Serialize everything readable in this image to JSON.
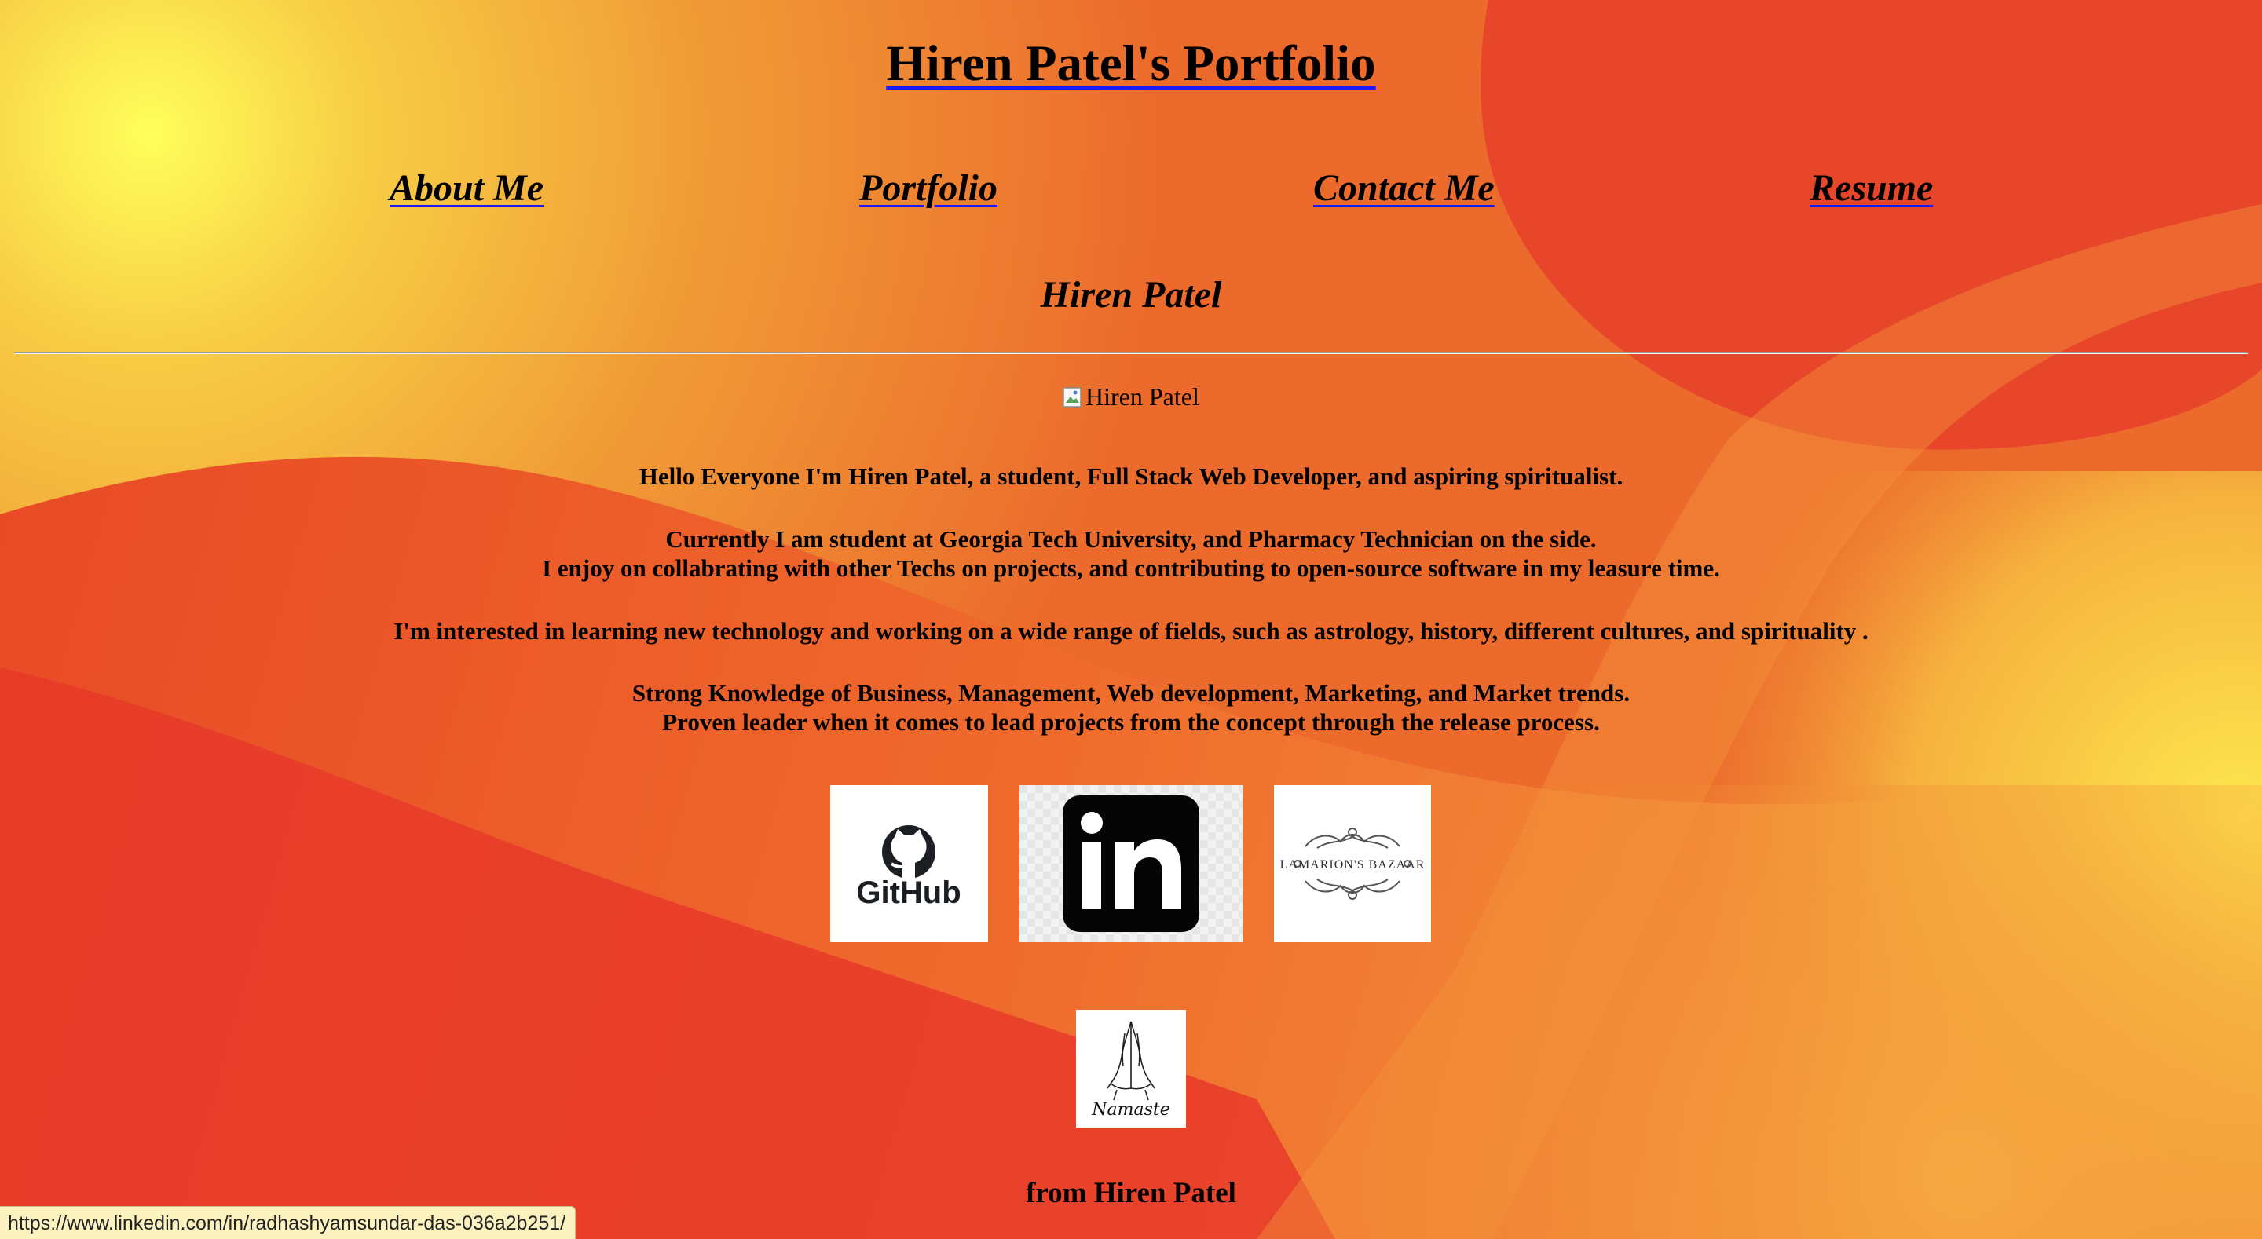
{
  "header": {
    "title": "Hiren Patel's Portfolio"
  },
  "nav": {
    "items": [
      {
        "label": "About Me"
      },
      {
        "label": "Portfolio"
      },
      {
        "label": "Contact Me"
      },
      {
        "label": "Resume"
      }
    ]
  },
  "about": {
    "heading": "Hiren Patel",
    "image_alt": "Hiren Patel",
    "intro": "Hello Everyone I'm Hiren Patel, a student, Full Stack Web Developer, and aspiring spiritualist.",
    "line_student": "Currently I am student at Georgia Tech University, and Pharmacy Technician on the side.",
    "line_collab": "I enjoy on collabrating with other Techs on projects, and contributing to open-source software in my leasure time.",
    "line_interests": "I'm interested in learning new technology and working on a wide range of fields, such as astrology, history, different cultures, and spirituality .",
    "line_knowledge": "Strong Knowledge of Business, Management, Web development, Marketing, and Market trends.",
    "line_leader": "Proven leader when it comes to lead projects from the concept through the release process."
  },
  "social": {
    "github_label": "GitHub",
    "linkedin_label": "in",
    "bazaar_label": "LAMARION'S BAZAAR",
    "namaste_label": "Namaste"
  },
  "footer": {
    "sign_off": "from Hiren Patel"
  },
  "status_bar": {
    "url": "https://www.linkedin.com/in/radhashyamsundar-das-036a2b251/"
  },
  "colors": {
    "bg_yellow": "#fff85a",
    "bg_orange": "#f0722c",
    "bg_red": "#e83a24",
    "link_underline": "#1a1aff"
  }
}
